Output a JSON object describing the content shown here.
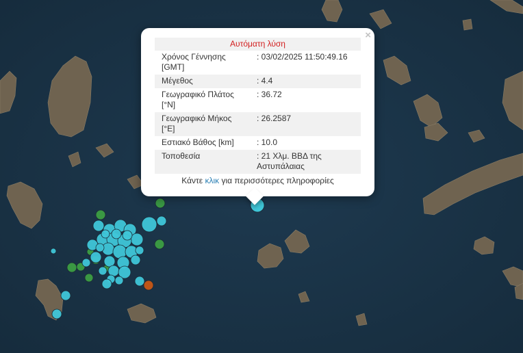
{
  "popup": {
    "header": "Αυτόματη λύση",
    "close_symbol": "×",
    "rows": [
      {
        "label": "Χρόνος Γέννησης [GMT]",
        "value": ": 03/02/2025 11:50:49.16"
      },
      {
        "label": "Μέγεθος",
        "value": ": 4.4"
      },
      {
        "label": "Γεωγραφικό Πλάτος [°N]",
        "value": ": 36.72"
      },
      {
        "label": "Γεωγραφικό Μήκος [°E]",
        "value": ": 26.2587"
      },
      {
        "label": "Εστιακό Βάθος [km]",
        "value": ": 10.0"
      },
      {
        "label": "Τοποθεσία",
        "value": ": 21 Χλμ. ΒΒΔ της Αστυπάλαιας"
      }
    ],
    "footer_prefix": "Κάντε",
    "footer_link": "κλικ",
    "footer_suffix": "για περισσότερες πληροφορίες"
  },
  "colors": {
    "sea": "#1b3347",
    "land": "#6f6350",
    "quake_cyan": "#3fc6d8",
    "quake_green": "#3c9e43",
    "quake_orange": "#c65716"
  },
  "icons": [
    "close-icon",
    "earthquake-marker"
  ]
}
